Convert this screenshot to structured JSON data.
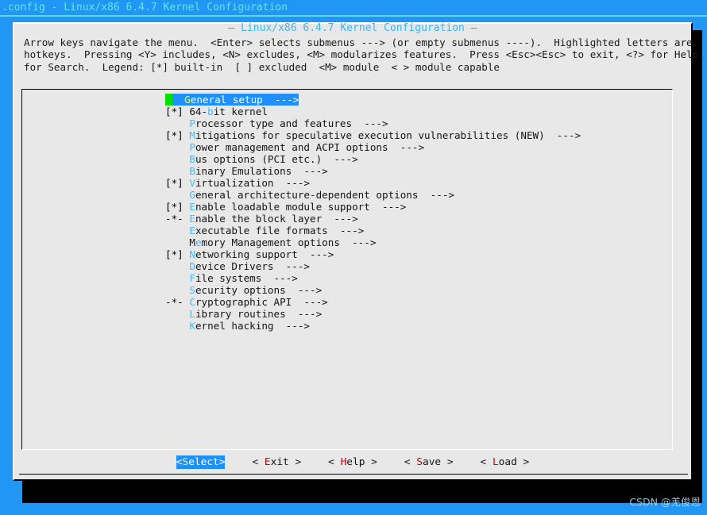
{
  "titlebar": {
    "text": ".config - Linux/x86 6.4.7 Kernel Configuration"
  },
  "dialog": {
    "title": "Linux/x86 6.4.7 Kernel Configuration",
    "title_dash_left": "— ",
    "title_dash_right": " —",
    "help_line1": "Arrow keys navigate the menu.  <Enter> selects submenus ---> (or empty submenus ----).  Highlighted letters are",
    "help_line2": "hotkeys.  Pressing <Y> includes, <N> excludes, <M> modularizes features.  Press <Esc><Esc> to exit, <?> for Help, </>",
    "help_line3": "for Search.  Legend: [*] built-in  [ ] excluded  <M> module  < > module capable"
  },
  "menu": {
    "items": [
      {
        "mark": "   ",
        "hot": "G",
        "rest": "eneral setup",
        "arrow": "  --->",
        "selected": true
      },
      {
        "mark": "[*]",
        "pre": "64-",
        "hot": "b",
        "rest": "it kernel",
        "arrow": "",
        "selected": false
      },
      {
        "mark": "   ",
        "hot": "P",
        "rest": "rocessor type and features",
        "arrow": "  --->",
        "selected": false
      },
      {
        "mark": "[*]",
        "hot": "M",
        "rest": "itigations for speculative execution vulnerabilities (NEW)",
        "arrow": "  --->",
        "selected": false
      },
      {
        "mark": "   ",
        "hot": "P",
        "rest": "ower management and ACPI options",
        "arrow": "  --->",
        "selected": false
      },
      {
        "mark": "   ",
        "hot": "B",
        "rest": "us options (PCI etc.)",
        "arrow": "  --->",
        "selected": false
      },
      {
        "mark": "   ",
        "hot": "B",
        "rest": "inary Emulations",
        "arrow": "  --->",
        "selected": false
      },
      {
        "mark": "[*]",
        "hot": "V",
        "rest": "irtualization",
        "arrow": "  --->",
        "selected": false
      },
      {
        "mark": "   ",
        "hot": "G",
        "rest": "eneral architecture-dependent options",
        "arrow": "  --->",
        "selected": false
      },
      {
        "mark": "[*]",
        "hot": "E",
        "rest": "nable loadable module support",
        "arrow": "  --->",
        "selected": false
      },
      {
        "mark": "-*-",
        "hot": "E",
        "rest": "nable the block layer",
        "arrow": "  --->",
        "selected": false
      },
      {
        "mark": "   ",
        "hot": "E",
        "rest": "xecutable file formats",
        "arrow": "  --->",
        "selected": false
      },
      {
        "mark": "   ",
        "pre": "M",
        "hot": "e",
        "rest": "mory Management options",
        "arrow": "  --->",
        "selected": false
      },
      {
        "mark": "[*]",
        "hot": "N",
        "rest": "etworking support",
        "arrow": "  --->",
        "selected": false
      },
      {
        "mark": "   ",
        "hot": "D",
        "rest": "evice Drivers",
        "arrow": "  --->",
        "selected": false
      },
      {
        "mark": "   ",
        "hot": "F",
        "rest": "ile systems",
        "arrow": "  --->",
        "selected": false
      },
      {
        "mark": "   ",
        "hot": "S",
        "rest": "ecurity options",
        "arrow": "  --->",
        "selected": false
      },
      {
        "mark": "-*-",
        "hot": "C",
        "rest": "ryptographic API",
        "arrow": "  --->",
        "selected": false
      },
      {
        "mark": "   ",
        "hot": "L",
        "rest": "ibrary routines",
        "arrow": "  --->",
        "selected": false
      },
      {
        "mark": "   ",
        "hot": "K",
        "rest": "ernel hacking",
        "arrow": "  --->",
        "selected": false
      }
    ]
  },
  "buttons": [
    {
      "left": "<",
      "hot": "S",
      "rest": "elect",
      "right": ">",
      "active": true
    },
    {
      "left": "< ",
      "hot": "E",
      "rest": "xit",
      "right": " >",
      "active": false
    },
    {
      "left": "< ",
      "hot": "H",
      "rest": "elp",
      "right": " >",
      "active": false
    },
    {
      "left": "< ",
      "hot": "S",
      "rest": "ave",
      "right": " >",
      "active": false
    },
    {
      "left": "< ",
      "hot": "L",
      "rest": "oad",
      "right": " >",
      "active": false
    }
  ],
  "watermark": {
    "text": "CSDN @羌俊恩"
  },
  "colors": {
    "background": "#2196f3",
    "dialog_bg": "#e8e8e8",
    "title_cyan": "#3bb3f5",
    "hotkey_blue": "#4db6f7",
    "selected_bg": "#1e90ff",
    "cursor_green": "#00e000",
    "selected_hot": "#ffff00",
    "button_hot": "#cc0000"
  }
}
